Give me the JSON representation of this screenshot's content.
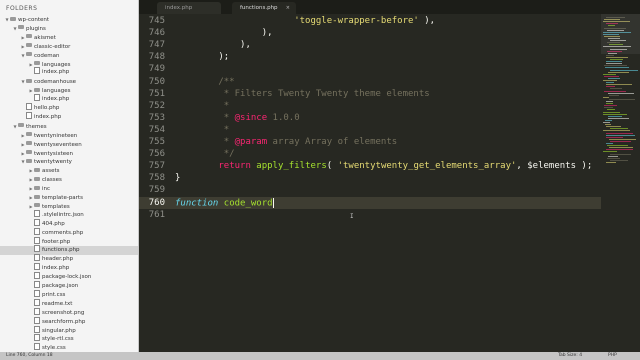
{
  "sidebar": {
    "title": "FOLDERS",
    "items": [
      {
        "label": "wp-content",
        "depth": 0,
        "type": "folder",
        "open": true
      },
      {
        "label": "plugins",
        "depth": 1,
        "type": "folder",
        "open": true
      },
      {
        "label": "akismet",
        "depth": 2,
        "type": "folder",
        "open": false
      },
      {
        "label": "classic-editor",
        "depth": 2,
        "type": "folder",
        "open": false
      },
      {
        "label": "codeman",
        "depth": 2,
        "type": "folder",
        "open": true
      },
      {
        "label": "languages",
        "depth": 3,
        "type": "folder",
        "open": false
      },
      {
        "label": "index.php",
        "depth": 3,
        "type": "file"
      },
      {
        "label": "codemanhouse",
        "depth": 2,
        "type": "folder",
        "open": true
      },
      {
        "label": "languages",
        "depth": 3,
        "type": "folder",
        "open": false
      },
      {
        "label": "index.php",
        "depth": 3,
        "type": "file"
      },
      {
        "label": "hello.php",
        "depth": 2,
        "type": "file"
      },
      {
        "label": "index.php",
        "depth": 2,
        "type": "file"
      },
      {
        "label": "themes",
        "depth": 1,
        "type": "folder",
        "open": true
      },
      {
        "label": "twentynineteen",
        "depth": 2,
        "type": "folder",
        "open": false
      },
      {
        "label": "twentyseventeen",
        "depth": 2,
        "type": "folder",
        "open": false
      },
      {
        "label": "twentysixteen",
        "depth": 2,
        "type": "folder",
        "open": false
      },
      {
        "label": "twentytwenty",
        "depth": 2,
        "type": "folder",
        "open": true
      },
      {
        "label": "assets",
        "depth": 3,
        "type": "folder",
        "open": false
      },
      {
        "label": "classes",
        "depth": 3,
        "type": "folder",
        "open": false
      },
      {
        "label": "inc",
        "depth": 3,
        "type": "folder",
        "open": false
      },
      {
        "label": "template-parts",
        "depth": 3,
        "type": "folder",
        "open": false
      },
      {
        "label": "templates",
        "depth": 3,
        "type": "folder",
        "open": false
      },
      {
        "label": ".stylelintrc.json",
        "depth": 3,
        "type": "file"
      },
      {
        "label": "404.php",
        "depth": 3,
        "type": "file"
      },
      {
        "label": "comments.php",
        "depth": 3,
        "type": "file"
      },
      {
        "label": "footer.php",
        "depth": 3,
        "type": "file"
      },
      {
        "label": "functions.php",
        "depth": 3,
        "type": "file",
        "selected": true
      },
      {
        "label": "header.php",
        "depth": 3,
        "type": "file"
      },
      {
        "label": "index.php",
        "depth": 3,
        "type": "file"
      },
      {
        "label": "package-lock.json",
        "depth": 3,
        "type": "file"
      },
      {
        "label": "package.json",
        "depth": 3,
        "type": "file"
      },
      {
        "label": "print.css",
        "depth": 3,
        "type": "file"
      },
      {
        "label": "readme.txt",
        "depth": 3,
        "type": "file"
      },
      {
        "label": "screenshot.png",
        "depth": 3,
        "type": "file"
      },
      {
        "label": "searchform.php",
        "depth": 3,
        "type": "file"
      },
      {
        "label": "singular.php",
        "depth": 3,
        "type": "file"
      },
      {
        "label": "style-rtl.css",
        "depth": 3,
        "type": "file"
      },
      {
        "label": "style.css",
        "depth": 3,
        "type": "file"
      }
    ]
  },
  "tabs": [
    {
      "label": "index.php",
      "active": false
    },
    {
      "label": "functions.php",
      "active": true,
      "close": "×"
    }
  ],
  "editor": {
    "current_line": "760",
    "lines": [
      {
        "n": "745",
        "tokens": [
          {
            "t": "                      ",
            "c": ""
          },
          {
            "t": "'toggle-wrapper-before'",
            "c": "str"
          },
          {
            "t": " ),",
            "c": ""
          }
        ]
      },
      {
        "n": "746",
        "tokens": [
          {
            "t": "                ),",
            "c": ""
          }
        ]
      },
      {
        "n": "747",
        "tokens": [
          {
            "t": "            ),",
            "c": ""
          }
        ]
      },
      {
        "n": "748",
        "tokens": [
          {
            "t": "        );",
            "c": ""
          }
        ]
      },
      {
        "n": "749",
        "tokens": []
      },
      {
        "n": "750",
        "tokens": [
          {
            "t": "        /**",
            "c": "cmt"
          }
        ]
      },
      {
        "n": "751",
        "tokens": [
          {
            "t": "         * Filters Twenty Twenty theme elements",
            "c": "cmt"
          }
        ]
      },
      {
        "n": "752",
        "tokens": [
          {
            "t": "         *",
            "c": "cmt"
          }
        ]
      },
      {
        "n": "753",
        "tokens": [
          {
            "t": "         * ",
            "c": "cmt"
          },
          {
            "t": "@since",
            "c": "tag"
          },
          {
            "t": " 1.0.0",
            "c": "cmt"
          }
        ]
      },
      {
        "n": "754",
        "tokens": [
          {
            "t": "         *",
            "c": "cmt"
          }
        ]
      },
      {
        "n": "755",
        "tokens": [
          {
            "t": "         * ",
            "c": "cmt"
          },
          {
            "t": "@param",
            "c": "tag"
          },
          {
            "t": " array Array of elements",
            "c": "cmt"
          }
        ]
      },
      {
        "n": "756",
        "tokens": [
          {
            "t": "         */",
            "c": "cmt"
          }
        ]
      },
      {
        "n": "757",
        "tokens": [
          {
            "t": "        ",
            "c": ""
          },
          {
            "t": "return",
            "c": "kw"
          },
          {
            "t": " ",
            "c": ""
          },
          {
            "t": "apply_filters",
            "c": "fn"
          },
          {
            "t": "( ",
            "c": ""
          },
          {
            "t": "'twentytwenty_get_elements_array'",
            "c": "str"
          },
          {
            "t": ", $elements );",
            "c": ""
          }
        ]
      },
      {
        "n": "758",
        "tokens": [
          {
            "t": "}",
            "c": ""
          }
        ]
      },
      {
        "n": "759",
        "tokens": []
      },
      {
        "n": "760",
        "tokens": [
          {
            "t": "function",
            "c": "it"
          },
          {
            "t": " ",
            "c": ""
          },
          {
            "t": "code_word",
            "c": "fn"
          }
        ],
        "cursor": true
      },
      {
        "n": "761",
        "tokens": []
      }
    ]
  },
  "status": {
    "left": "Line 760, Column 18",
    "tab_size": "Tab Size: 4",
    "syntax": "PHP"
  },
  "colors": {
    "editor_bg": "#272822",
    "comment": "#75715e",
    "keyword": "#f92672",
    "function": "#a6e22e",
    "string": "#e6db74",
    "storage": "#66d9ef"
  }
}
